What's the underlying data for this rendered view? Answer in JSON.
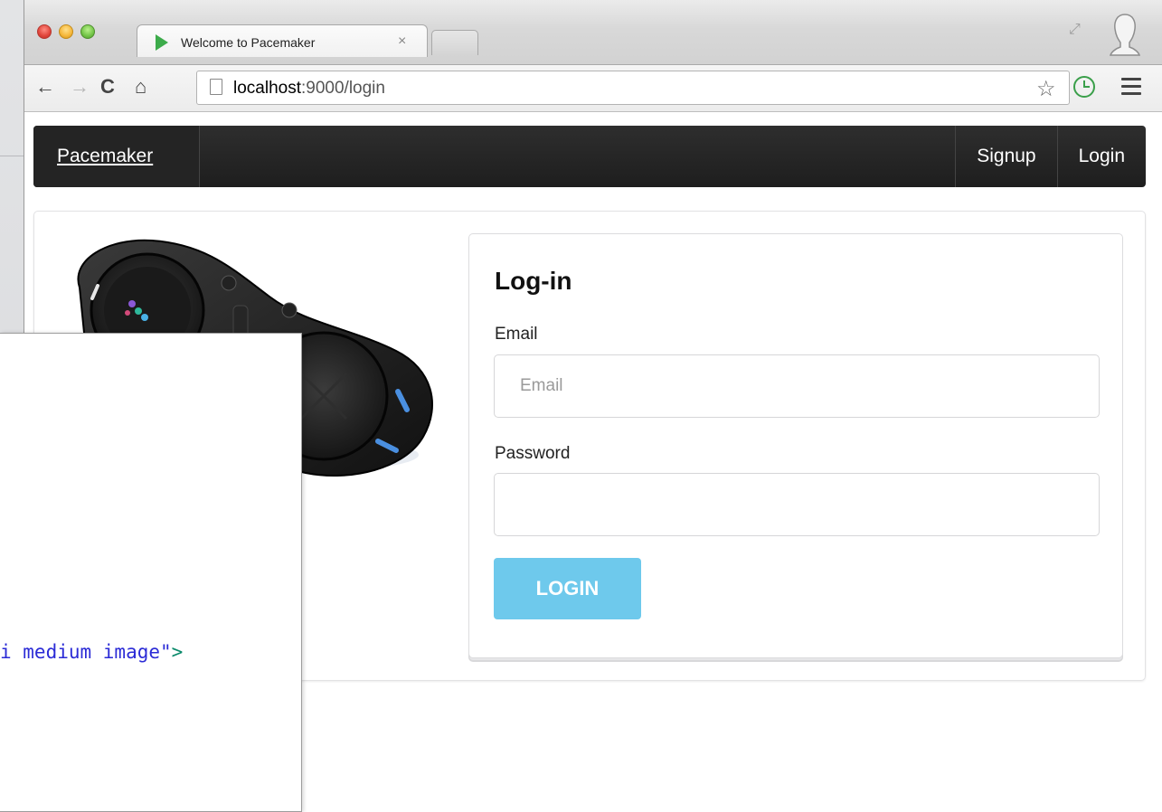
{
  "browser": {
    "tab_title": "Welcome to Pacemaker",
    "tab_close": "×",
    "url_host": "localhost",
    "url_rest": ":9000/login",
    "icons": {
      "back": "←",
      "forward": "→",
      "reload": "C",
      "home": "⌂",
      "star": "☆",
      "expand": "⤢"
    }
  },
  "navbar": {
    "brand": "Pacemaker",
    "items": [
      {
        "label": "Signup"
      },
      {
        "label": "Login"
      }
    ]
  },
  "login": {
    "title": "Log-in",
    "email_label": "Email",
    "email_placeholder": "Email",
    "password_label": "Password",
    "password_value": "",
    "button_label": "LOGIN"
  },
  "overlay": {
    "code_text": "i medium image\"",
    "code_close": ">"
  },
  "colors": {
    "navbar": "#1e1e1e",
    "login_button": "#6ec9ec",
    "favicon": "#3cab4a",
    "clock": "#3a9f4a"
  }
}
